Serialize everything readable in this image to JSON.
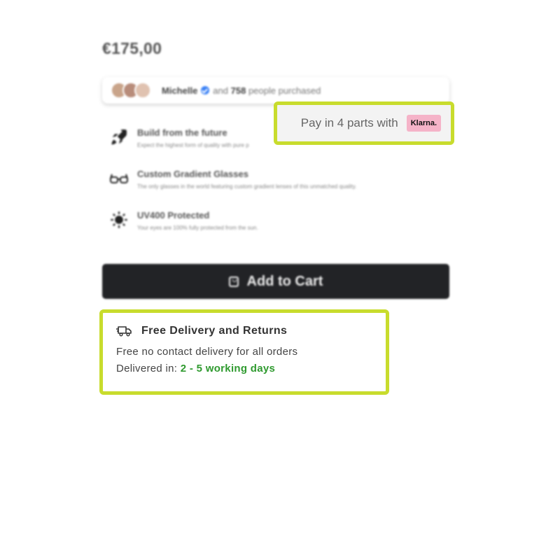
{
  "product": {
    "price": "€175,00"
  },
  "social_proof": {
    "name": "Michelle",
    "count": "758",
    "suffix": "people purchased",
    "connector": "and"
  },
  "features": [
    {
      "icon": "rocket-icon",
      "title": "Build from the future",
      "desc": "Expect the highest form of quality with pure p"
    },
    {
      "icon": "glasses-icon",
      "title": "Custom Gradient Glasses",
      "desc": "The only glasses in the world featuring custom gradient lenses of this unmatched quality."
    },
    {
      "icon": "sun-icon",
      "title": "UV400 Protected",
      "desc": "Your eyes are 100% fully protected from the sun."
    }
  ],
  "klarna": {
    "text": "Pay in 4 parts with",
    "badge": "Klarna."
  },
  "cart": {
    "label": "Add to Cart"
  },
  "delivery": {
    "title": "Free Delivery and Returns",
    "line1": "Free no contact delivery for all orders",
    "line2_prefix": "Delivered in:",
    "line2_days": "2 - 5 working days"
  },
  "colors": {
    "highlight": "#c8dc2d",
    "button_bg": "#222326",
    "days_green": "#2f9a2f",
    "klarna_pink": "#f5b3c8"
  }
}
